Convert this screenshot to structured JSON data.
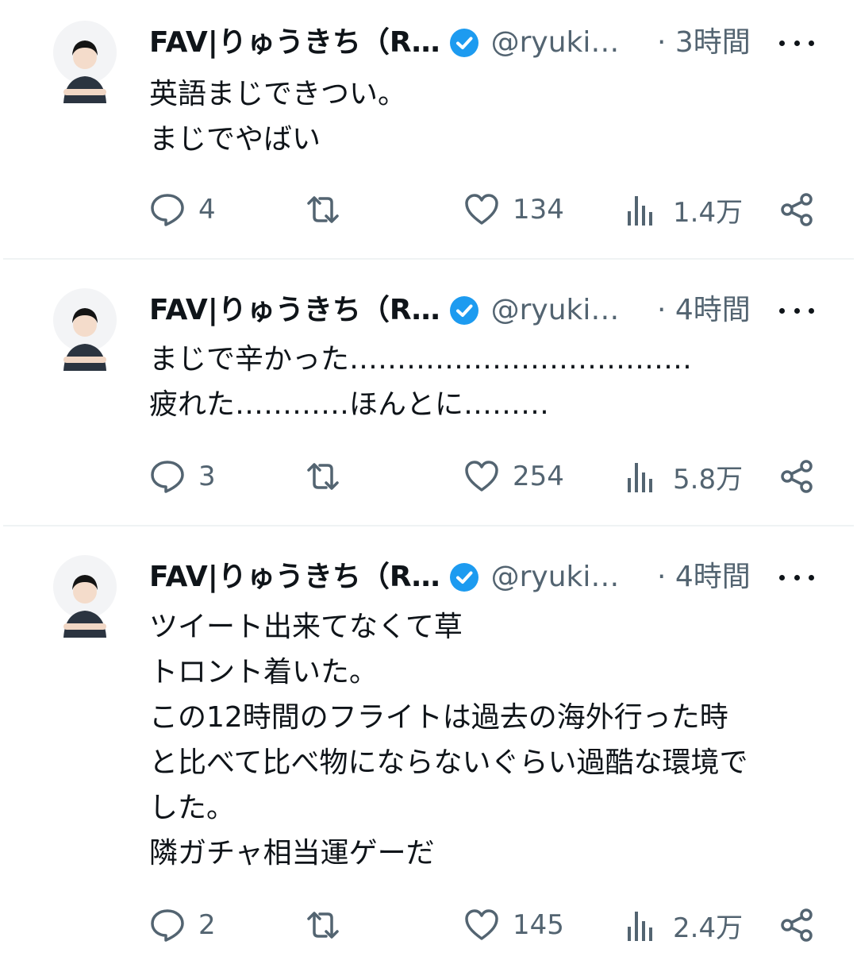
{
  "colors": {
    "text": "#0f1419",
    "secondary": "#536471",
    "verified": "#1d9bf0",
    "divider": "#eff3f4"
  },
  "icons": [
    "avatar",
    "verified-badge-icon",
    "more-icon",
    "reply-icon",
    "retweet-icon",
    "like-icon",
    "views-icon",
    "share-icon"
  ],
  "tweets": [
    {
      "author": {
        "name": "FAV|りゅうきち（R…",
        "handle": "@ryuki…"
      },
      "time": "· 3時間",
      "lines": [
        "英語まじできつい。",
        "まじでやばい"
      ],
      "stats": {
        "replies": "4",
        "likes": "134",
        "views": "1.4万"
      }
    },
    {
      "author": {
        "name": "FAV|りゅうきち（R…",
        "handle": "@ryuki…"
      },
      "time": "· 4時間",
      "lines": [
        "まじで辛かった………………………………",
        "疲れた…………ほんとに………"
      ],
      "stats": {
        "replies": "3",
        "likes": "254",
        "views": "5.8万"
      }
    },
    {
      "author": {
        "name": "FAV|りゅうきち（R…",
        "handle": "@ryuki…"
      },
      "time": "· 4時間",
      "lines": [
        "ツイート出来てなくて草",
        "トロント着いた。",
        "この12時間のフライトは過去の海外行った時",
        "と比べて比べ物にならないぐらい過酷な環境で",
        "した。",
        "隣ガチャ相当運ゲーだ"
      ],
      "stats": {
        "replies": "2",
        "likes": "145",
        "views": "2.4万"
      }
    }
  ]
}
